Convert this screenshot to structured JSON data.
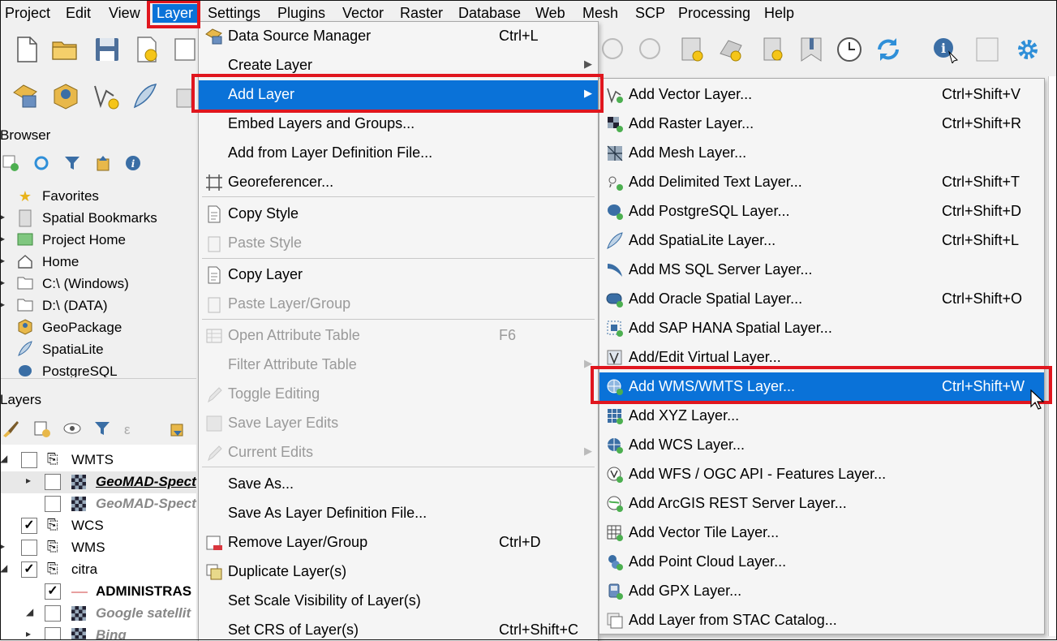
{
  "menubar": {
    "items": [
      "Project",
      "Edit",
      "View",
      "Layer",
      "Settings",
      "Plugins",
      "Vector",
      "Raster",
      "Database",
      "Web",
      "Mesh",
      "SCP",
      "Processing",
      "Help"
    ]
  },
  "browser": {
    "title": "Browser",
    "items": [
      "Favorites",
      "Spatial Bookmarks",
      "Project Home",
      "Home",
      "C:\\ (Windows)",
      "D:\\ (DATA)",
      "GeoPackage",
      "SpatiaLite",
      "PostgreSQL"
    ]
  },
  "layers": {
    "title": "Layers",
    "items": [
      {
        "label": "WMTS",
        "checked": false
      },
      {
        "label": "GeoMAD-Spect",
        "checked": false
      },
      {
        "label": "GeoMAD-Spect",
        "checked": false
      },
      {
        "label": "WCS",
        "checked": true
      },
      {
        "label": "WMS",
        "checked": false
      },
      {
        "label": "citra",
        "checked": true
      },
      {
        "label": "ADMINISTRAS",
        "checked": true
      },
      {
        "label": "Google satellit",
        "checked": false
      },
      {
        "label": "Bing",
        "checked": false
      }
    ]
  },
  "layer_menu": {
    "items": [
      {
        "label": "Data Source Manager",
        "shortcut": "Ctrl+L",
        "icon": "data-source-manager"
      },
      {
        "label": "Create Layer",
        "submenu": true
      },
      {
        "label": "Add Layer",
        "submenu": true,
        "highlighted": true
      },
      {
        "label": "Embed Layers and Groups..."
      },
      {
        "label": "Add from Layer Definition File..."
      },
      {
        "label": "Georeferencer...",
        "icon": "georeferencer"
      },
      {
        "label": "Copy Style",
        "icon": "copy-style"
      },
      {
        "label": "Paste Style",
        "disabled": true,
        "icon": "paste-style"
      },
      {
        "label": "Copy Layer",
        "icon": "copy-layer"
      },
      {
        "label": "Paste Layer/Group",
        "disabled": true,
        "icon": "paste-layer"
      },
      {
        "label": "Open Attribute Table",
        "shortcut": "F6",
        "disabled": true,
        "icon": "attribute-table"
      },
      {
        "label": "Filter Attribute Table",
        "disabled": true,
        "submenu": true
      },
      {
        "label": "Toggle Editing",
        "disabled": true,
        "icon": "pencil"
      },
      {
        "label": "Save Layer Edits",
        "disabled": true,
        "icon": "save-edits"
      },
      {
        "label": "Current Edits",
        "disabled": true,
        "submenu": true,
        "icon": "current-edits"
      },
      {
        "label": "Save As..."
      },
      {
        "label": "Save As Layer Definition File..."
      },
      {
        "label": "Remove Layer/Group",
        "shortcut": "Ctrl+D",
        "icon": "remove-layer"
      },
      {
        "label": "Duplicate Layer(s)",
        "icon": "duplicate-layer"
      },
      {
        "label": "Set Scale Visibility of Layer(s)"
      },
      {
        "label": "Set CRS of Layer(s)",
        "shortcut": "Ctrl+Shift+C"
      }
    ]
  },
  "add_layer_menu": {
    "items": [
      {
        "label": "Add Vector Layer...",
        "shortcut": "Ctrl+Shift+V",
        "icon": "vector-layer"
      },
      {
        "label": "Add Raster Layer...",
        "shortcut": "Ctrl+Shift+R",
        "icon": "raster-layer"
      },
      {
        "label": "Add Mesh Layer...",
        "icon": "mesh-layer"
      },
      {
        "label": "Add Delimited Text Layer...",
        "shortcut": "Ctrl+Shift+T",
        "icon": "delimited-text"
      },
      {
        "label": "Add PostgreSQL Layer...",
        "shortcut": "Ctrl+Shift+D",
        "icon": "postgresql"
      },
      {
        "label": "Add SpatiaLite Layer...",
        "shortcut": "Ctrl+Shift+L",
        "icon": "spatialite"
      },
      {
        "label": "Add MS SQL Server Layer...",
        "icon": "mssql"
      },
      {
        "label": "Add Oracle Spatial Layer...",
        "shortcut": "Ctrl+Shift+O",
        "icon": "oracle"
      },
      {
        "label": "Add SAP HANA Spatial Layer...",
        "icon": "hana"
      },
      {
        "label": "Add/Edit Virtual Layer...",
        "icon": "virtual-layer"
      },
      {
        "label": "Add WMS/WMTS Layer...",
        "shortcut": "Ctrl+Shift+W",
        "highlighted": true,
        "icon": "wms"
      },
      {
        "label": "Add XYZ Layer...",
        "icon": "xyz"
      },
      {
        "label": "Add WCS Layer...",
        "icon": "wcs"
      },
      {
        "label": "Add WFS / OGC API - Features Layer...",
        "icon": "wfs"
      },
      {
        "label": "Add ArcGIS REST Server Layer...",
        "icon": "arcgis"
      },
      {
        "label": "Add Vector Tile Layer...",
        "icon": "vector-tile"
      },
      {
        "label": "Add Point Cloud Layer...",
        "icon": "point-cloud"
      },
      {
        "label": "Add GPX Layer...",
        "icon": "gpx"
      },
      {
        "label": "Add Layer from STAC Catalog...",
        "icon": "stac"
      }
    ]
  },
  "colors": {
    "highlight": "#0a72d8",
    "annotation_red": "#e0161e"
  }
}
